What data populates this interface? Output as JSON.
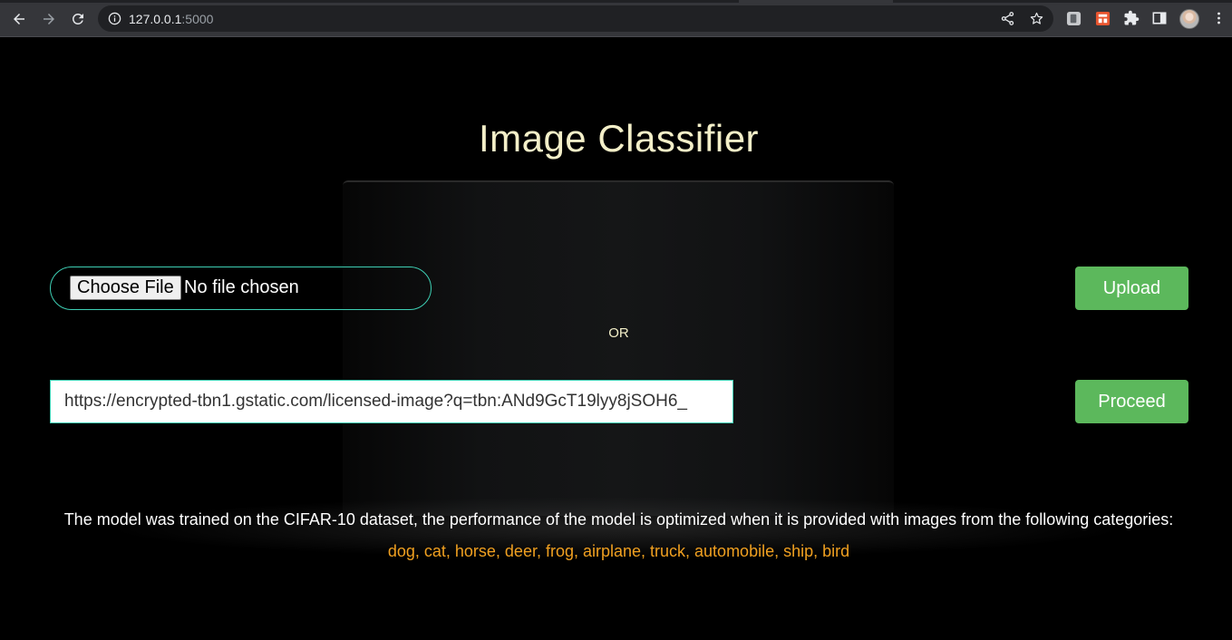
{
  "browser": {
    "url_host": "127.0.0.1",
    "url_port": ":5000"
  },
  "page": {
    "title": "Image Classifier",
    "file_input": {
      "button_label": "Choose File",
      "status": "No file chosen"
    },
    "upload_label": "Upload",
    "or_label": "OR",
    "url_input_value": "https://encrypted-tbn1.gstatic.com/licensed-image?q=tbn:ANd9GcT19lyy8jSOH6_",
    "proceed_label": "Proceed",
    "note": "The model was trained on the CIFAR-10 dataset, the performance of the model is optimized when it is provided with images from the following categories:",
    "categories": "dog, cat, horse, deer, frog, airplane, truck, automobile, ship, bird"
  },
  "colors": {
    "accent_green": "#5cb85c",
    "title_color": "#f3efc8",
    "category_color": "#f0a020",
    "input_border": "#3ecfb4"
  }
}
